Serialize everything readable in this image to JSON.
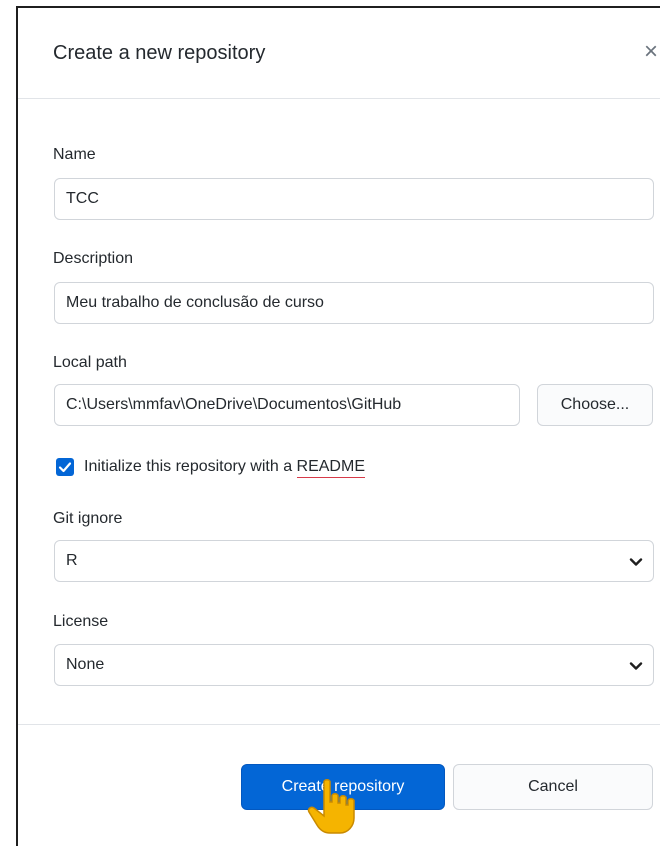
{
  "dialog": {
    "title": "Create a new repository",
    "close_symbol": "×"
  },
  "form": {
    "name_label": "Name",
    "name_value": "TCC",
    "description_label": "Description",
    "description_value": "Meu trabalho de conclusão de curso",
    "local_path_label": "Local path",
    "local_path_value": "C:\\Users\\mmfav\\OneDrive\\Documentos\\GitHub",
    "choose_button": "Choose...",
    "readme_checked": true,
    "readme_label_prefix": "Initialize this repository with a ",
    "readme_label_keyword": "README",
    "gitignore_label": "Git ignore",
    "gitignore_value": "R",
    "license_label": "License",
    "license_value": "None"
  },
  "footer": {
    "create_button": "Create repository",
    "cancel_button": "Cancel"
  },
  "icons": {
    "close": "close-icon",
    "checkbox": "checkmark-icon",
    "dropdown": "chevron-down-icon",
    "pointer": "hand-pointer-icon"
  },
  "colors": {
    "primary": "#0366d6",
    "border": "#d1d5da",
    "text": "#24292e",
    "spellcheck_underline": "#d73a49"
  }
}
